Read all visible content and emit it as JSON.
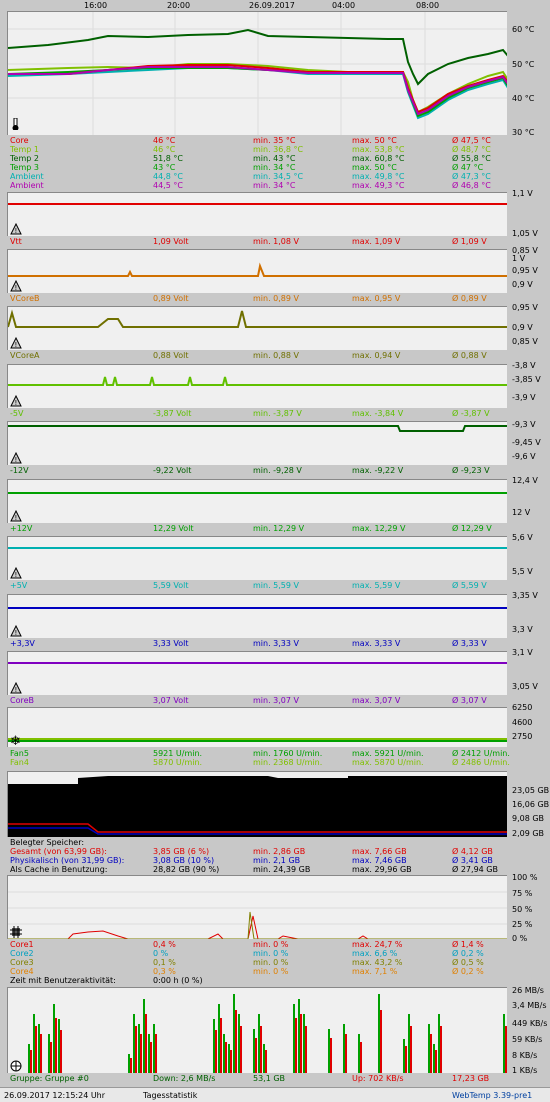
{
  "timeline": [
    "16:00",
    "20:00",
    "26.09.2017",
    "04:00",
    "08:00"
  ],
  "temp": {
    "axis": [
      "60 °C",
      "50 °C",
      "40 °C",
      "30 °C"
    ],
    "rows": [
      {
        "n": "Core",
        "v": "46 °C",
        "mi": "min. 35 °C",
        "ma": "max. 50 °C",
        "av": "Ø 47,5 °C",
        "col": "#e00000"
      },
      {
        "n": "Temp 1",
        "v": "46 °C",
        "mi": "min. 36,8 °C",
        "ma": "max. 53,8 °C",
        "av": "Ø 48,7 °C",
        "col": "#80c000"
      },
      {
        "n": "Temp 2",
        "v": "51,8 °C",
        "mi": "min. 43 °C",
        "ma": "max. 60,8 °C",
        "av": "Ø 55,8 °C",
        "col": "#006000"
      },
      {
        "n": "Temp 3",
        "v": "43 °C",
        "mi": "min. 34 °C",
        "ma": "max. 50 °C",
        "av": "Ø 47 °C",
        "col": "#00a000"
      },
      {
        "n": "Ambient",
        "v": "44,8 °C",
        "mi": "min. 34,5 °C",
        "ma": "max. 49,8 °C",
        "av": "Ø 47,3 °C",
        "col": "#00b0b0"
      },
      {
        "n": "Ambient",
        "v": "44,5 °C",
        "mi": "min. 34 °C",
        "ma": "max. 49,3 °C",
        "av": "Ø 46,8 °C",
        "col": "#b000b0"
      }
    ]
  },
  "volt": [
    {
      "n": "Vtt",
      "v": "1,09 Volt",
      "mi": "min. 1,08 V",
      "ma": "max. 1,09 V",
      "av": "Ø 1,09 V",
      "col": "#e00000",
      "axis": [
        "1,1 V",
        "1,05 V"
      ]
    },
    {
      "n": "VCoreB",
      "v": "0,89 Volt",
      "mi": "min. 0,89 V",
      "ma": "max. 0,95 V",
      "av": "Ø 0,89 V",
      "col": "#d07000",
      "axis": [
        "1 V",
        "0,95 V",
        "0,9 V",
        "0,85 V"
      ]
    },
    {
      "n": "VCoreA",
      "v": "0,88 Volt",
      "mi": "min. 0,88 V",
      "ma": "max. 0,94 V",
      "av": "Ø 0,88 V",
      "col": "#707000",
      "axis": [
        "0,95 V",
        "0,9 V",
        "0,85 V"
      ]
    },
    {
      "n": "-5V",
      "v": "-3,87 Volt",
      "mi": "min. -3,87 V",
      "ma": "max. -3,84 V",
      "av": "Ø -3,87 V",
      "col": "#60c000",
      "axis": [
        "-3,8 V",
        "-3,85 V",
        "-3,9 V"
      ]
    },
    {
      "n": "-12V",
      "v": "-9,22 Volt",
      "mi": "min. -9,28 V",
      "ma": "max. -9,22 V",
      "av": "Ø -9,23 V",
      "col": "#006000",
      "axis": [
        "-9,3 V",
        "-9,45 V",
        "-9,6 V"
      ]
    },
    {
      "n": "+12V",
      "v": "12,29 Volt",
      "mi": "min. 12,29 V",
      "ma": "max. 12,29 V",
      "av": "Ø 12,29 V",
      "col": "#00a000",
      "axis": [
        "12,4 V",
        "12 V"
      ]
    },
    {
      "n": "+5V",
      "v": "5,59 Volt",
      "mi": "min. 5,59 V",
      "ma": "max. 5,59 V",
      "av": "Ø 5,59 V",
      "col": "#00b0b0",
      "axis": [
        "5,6 V",
        "5,5 V"
      ]
    },
    {
      "n": "+3,3V",
      "v": "3,33 Volt",
      "mi": "min. 3,33 V",
      "ma": "max. 3,33 V",
      "av": "Ø 3,33 V",
      "col": "#0000c0",
      "axis": [
        "3,35 V",
        "3,3 V"
      ]
    },
    {
      "n": "CoreB",
      "v": "3,07 Volt",
      "mi": "min. 3,07 V",
      "ma": "max. 3,07 V",
      "av": "Ø 3,07 V",
      "col": "#8000c0",
      "axis": [
        "3,1 V",
        "3,05 V"
      ]
    }
  ],
  "fan": {
    "axis": [
      "6250",
      "4600",
      "2750"
    ],
    "rows": [
      {
        "n": "Fan5",
        "v": "5921 U/min.",
        "mi": "min. 1760 U/min.",
        "ma": "max. 5921 U/min.",
        "av": "Ø 2412 U/min.",
        "col": "#00a000"
      },
      {
        "n": "Fan4",
        "v": "5870 U/min.",
        "mi": "min. 2368 U/min.",
        "ma": "max. 5870 U/min.",
        "av": "Ø 2486 U/min.",
        "col": "#80c000"
      }
    ]
  },
  "mem": {
    "axis": [
      "23,05 GB",
      "16,06 GB",
      "9,08 GB",
      "2,09 GB"
    ],
    "title": "Belegter Speicher:",
    "rows": [
      {
        "n": "Gesamt (von 63,99 GB):",
        "v": "3,85 GB (6 %)",
        "mi": "min. 2,86 GB",
        "ma": "max. 7,66 GB",
        "av": "Ø 4,12 GB",
        "col": "#e00000"
      },
      {
        "n": "Physikalisch (von 31,99 GB):",
        "v": "3,08 GB (10 %)",
        "mi": "min. 2,1 GB",
        "ma": "max. 7,46 GB",
        "av": "Ø 3,41 GB",
        "col": "#0000c0"
      },
      {
        "n": "Als Cache in Benutzung:",
        "v": "28,82 GB (90 %)",
        "mi": "min. 24,39 GB",
        "ma": "max. 29,96 GB",
        "av": "Ø 27,94 GB",
        "col": "#000000"
      }
    ]
  },
  "cpu": {
    "axis": [
      "100 %",
      "75 %",
      "50 %",
      "25 %",
      "0 %"
    ],
    "rows": [
      {
        "n": "Core1",
        "v": "0,4 %",
        "mi": "min. 0 %",
        "ma": "max. 24,7 %",
        "av": "Ø 1,4 %",
        "col": "#e00000"
      },
      {
        "n": "Core2",
        "v": "0 %",
        "mi": "min. 0 %",
        "ma": "max. 6,6 %",
        "av": "Ø 0,2 %",
        "col": "#00a0c0"
      },
      {
        "n": "Core3",
        "v": "0,1 %",
        "mi": "min. 0 %",
        "ma": "max. 43,2 %",
        "av": "Ø 0,5 %",
        "col": "#808000"
      },
      {
        "n": "Core4",
        "v": "0,3 %",
        "mi": "min. 0 %",
        "ma": "max. 7,1 %",
        "av": "Ø 0,2 %",
        "col": "#e08000"
      }
    ],
    "idle_label": "Zeit mit Benutzeraktivität:",
    "idle_value": "0:00 h (0 %)"
  },
  "net": {
    "axis": [
      "26 MB/s",
      "3,4 MB/s",
      "449 KB/s",
      "59 KB/s",
      "8 KB/s",
      "1 KB/s"
    ],
    "group": "Gruppe: Gruppe #0",
    "down": "Down: 2,6 MB/s",
    "down_total": "53,1 GB",
    "up": "Up: 702 KB/s",
    "up_total": "17,23 GB"
  },
  "footer": {
    "datetime": "26.09.2017 12:15:24 Uhr",
    "stats": "Tagesstatistik",
    "version": "WebTemp 3.39-pre1"
  }
}
